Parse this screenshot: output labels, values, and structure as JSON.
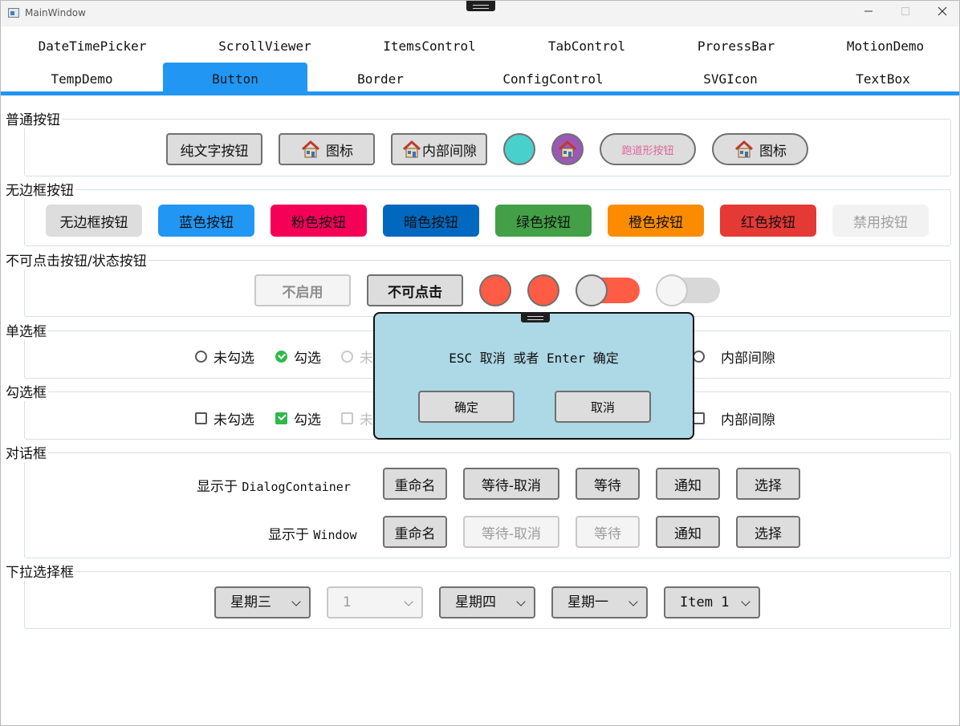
{
  "window": {
    "title": "MainWindow"
  },
  "tabs": [
    {
      "label": "DateTimePicker"
    },
    {
      "label": "ScrollViewer"
    },
    {
      "label": "ItemsControl"
    },
    {
      "label": "TabControl"
    },
    {
      "label": "ProressBar"
    },
    {
      "label": "MotionDemo"
    },
    {
      "label": "TempDemo"
    },
    {
      "label": "Button"
    },
    {
      "label": "Border"
    },
    {
      "label": "ConfigControl"
    },
    {
      "label": "SVGIcon"
    },
    {
      "label": "TextBox"
    }
  ],
  "selected_tab": "Button",
  "normal": {
    "title": "普通按钮",
    "text_button": "纯文字按钮",
    "icon_button": "图标",
    "padding_button": "内部间隙",
    "track_button": "跑道形按钮",
    "pill_icon_button": "图标"
  },
  "borderless": {
    "title": "无边框按钮",
    "buttons": [
      {
        "label": "无边框按钮",
        "bg": "#dddddd",
        "fg": "#111111"
      },
      {
        "label": "蓝色按钮",
        "bg": "#2196f3",
        "fg": "#111111"
      },
      {
        "label": "粉色按钮",
        "bg": "#f50057",
        "fg": "#111111"
      },
      {
        "label": "暗色按钮",
        "bg": "#0168c0",
        "fg": "#111111"
      },
      {
        "label": "绿色按钮",
        "bg": "#43a047",
        "fg": "#111111"
      },
      {
        "label": "橙色按钮",
        "bg": "#fb8c00",
        "fg": "#111111"
      },
      {
        "label": "红色按钮",
        "bg": "#e53935",
        "fg": "#111111"
      },
      {
        "label": "禁用按钮",
        "bg": "#f2f2f2",
        "fg": "#9e9e9e"
      }
    ]
  },
  "state": {
    "title": "不可点击按钮/状态按钮",
    "disabled_button": "不启用",
    "unclickable_button": "不可点击",
    "status_color": "#ff5c46",
    "toggle_on": true,
    "toggle_off": false
  },
  "radio": {
    "title": "单选框",
    "items": [
      {
        "label": "未勾选",
        "checked": false,
        "disabled": false
      },
      {
        "label": "勾选",
        "checked": true,
        "disabled": false
      },
      {
        "label": "未",
        "checked": false,
        "disabled": true
      },
      {
        "label": "内部间隙",
        "checked": false,
        "disabled": false
      }
    ]
  },
  "checkbox": {
    "title": "勾选框",
    "items": [
      {
        "label": "未勾选",
        "checked": false,
        "disabled": false
      },
      {
        "label": "勾选",
        "checked": true,
        "disabled": false
      },
      {
        "label": "未",
        "checked": false,
        "disabled": true
      },
      {
        "label": "内部间隙",
        "checked": false,
        "disabled": false
      }
    ]
  },
  "dialog": {
    "title": "对话框",
    "row1_prefix": "显示于",
    "row1_target": "DialogContainer",
    "row2_prefix": "显示于",
    "row2_target": "Window",
    "rename": "重命名",
    "wait_cancel": "等待-取消",
    "wait": "等待",
    "notify": "通知",
    "choose": "选择"
  },
  "combo": {
    "title": "下拉选择框",
    "values": [
      {
        "value": "星期三",
        "disabled": false
      },
      {
        "value": "1",
        "disabled": true
      },
      {
        "value": "星期四",
        "disabled": false
      },
      {
        "value": "星期一",
        "disabled": false
      },
      {
        "value": "Item 1",
        "disabled": false
      }
    ]
  },
  "modal": {
    "message": "ESC 取消 或者 Enter 确定",
    "ok": "确定",
    "cancel": "取消"
  }
}
